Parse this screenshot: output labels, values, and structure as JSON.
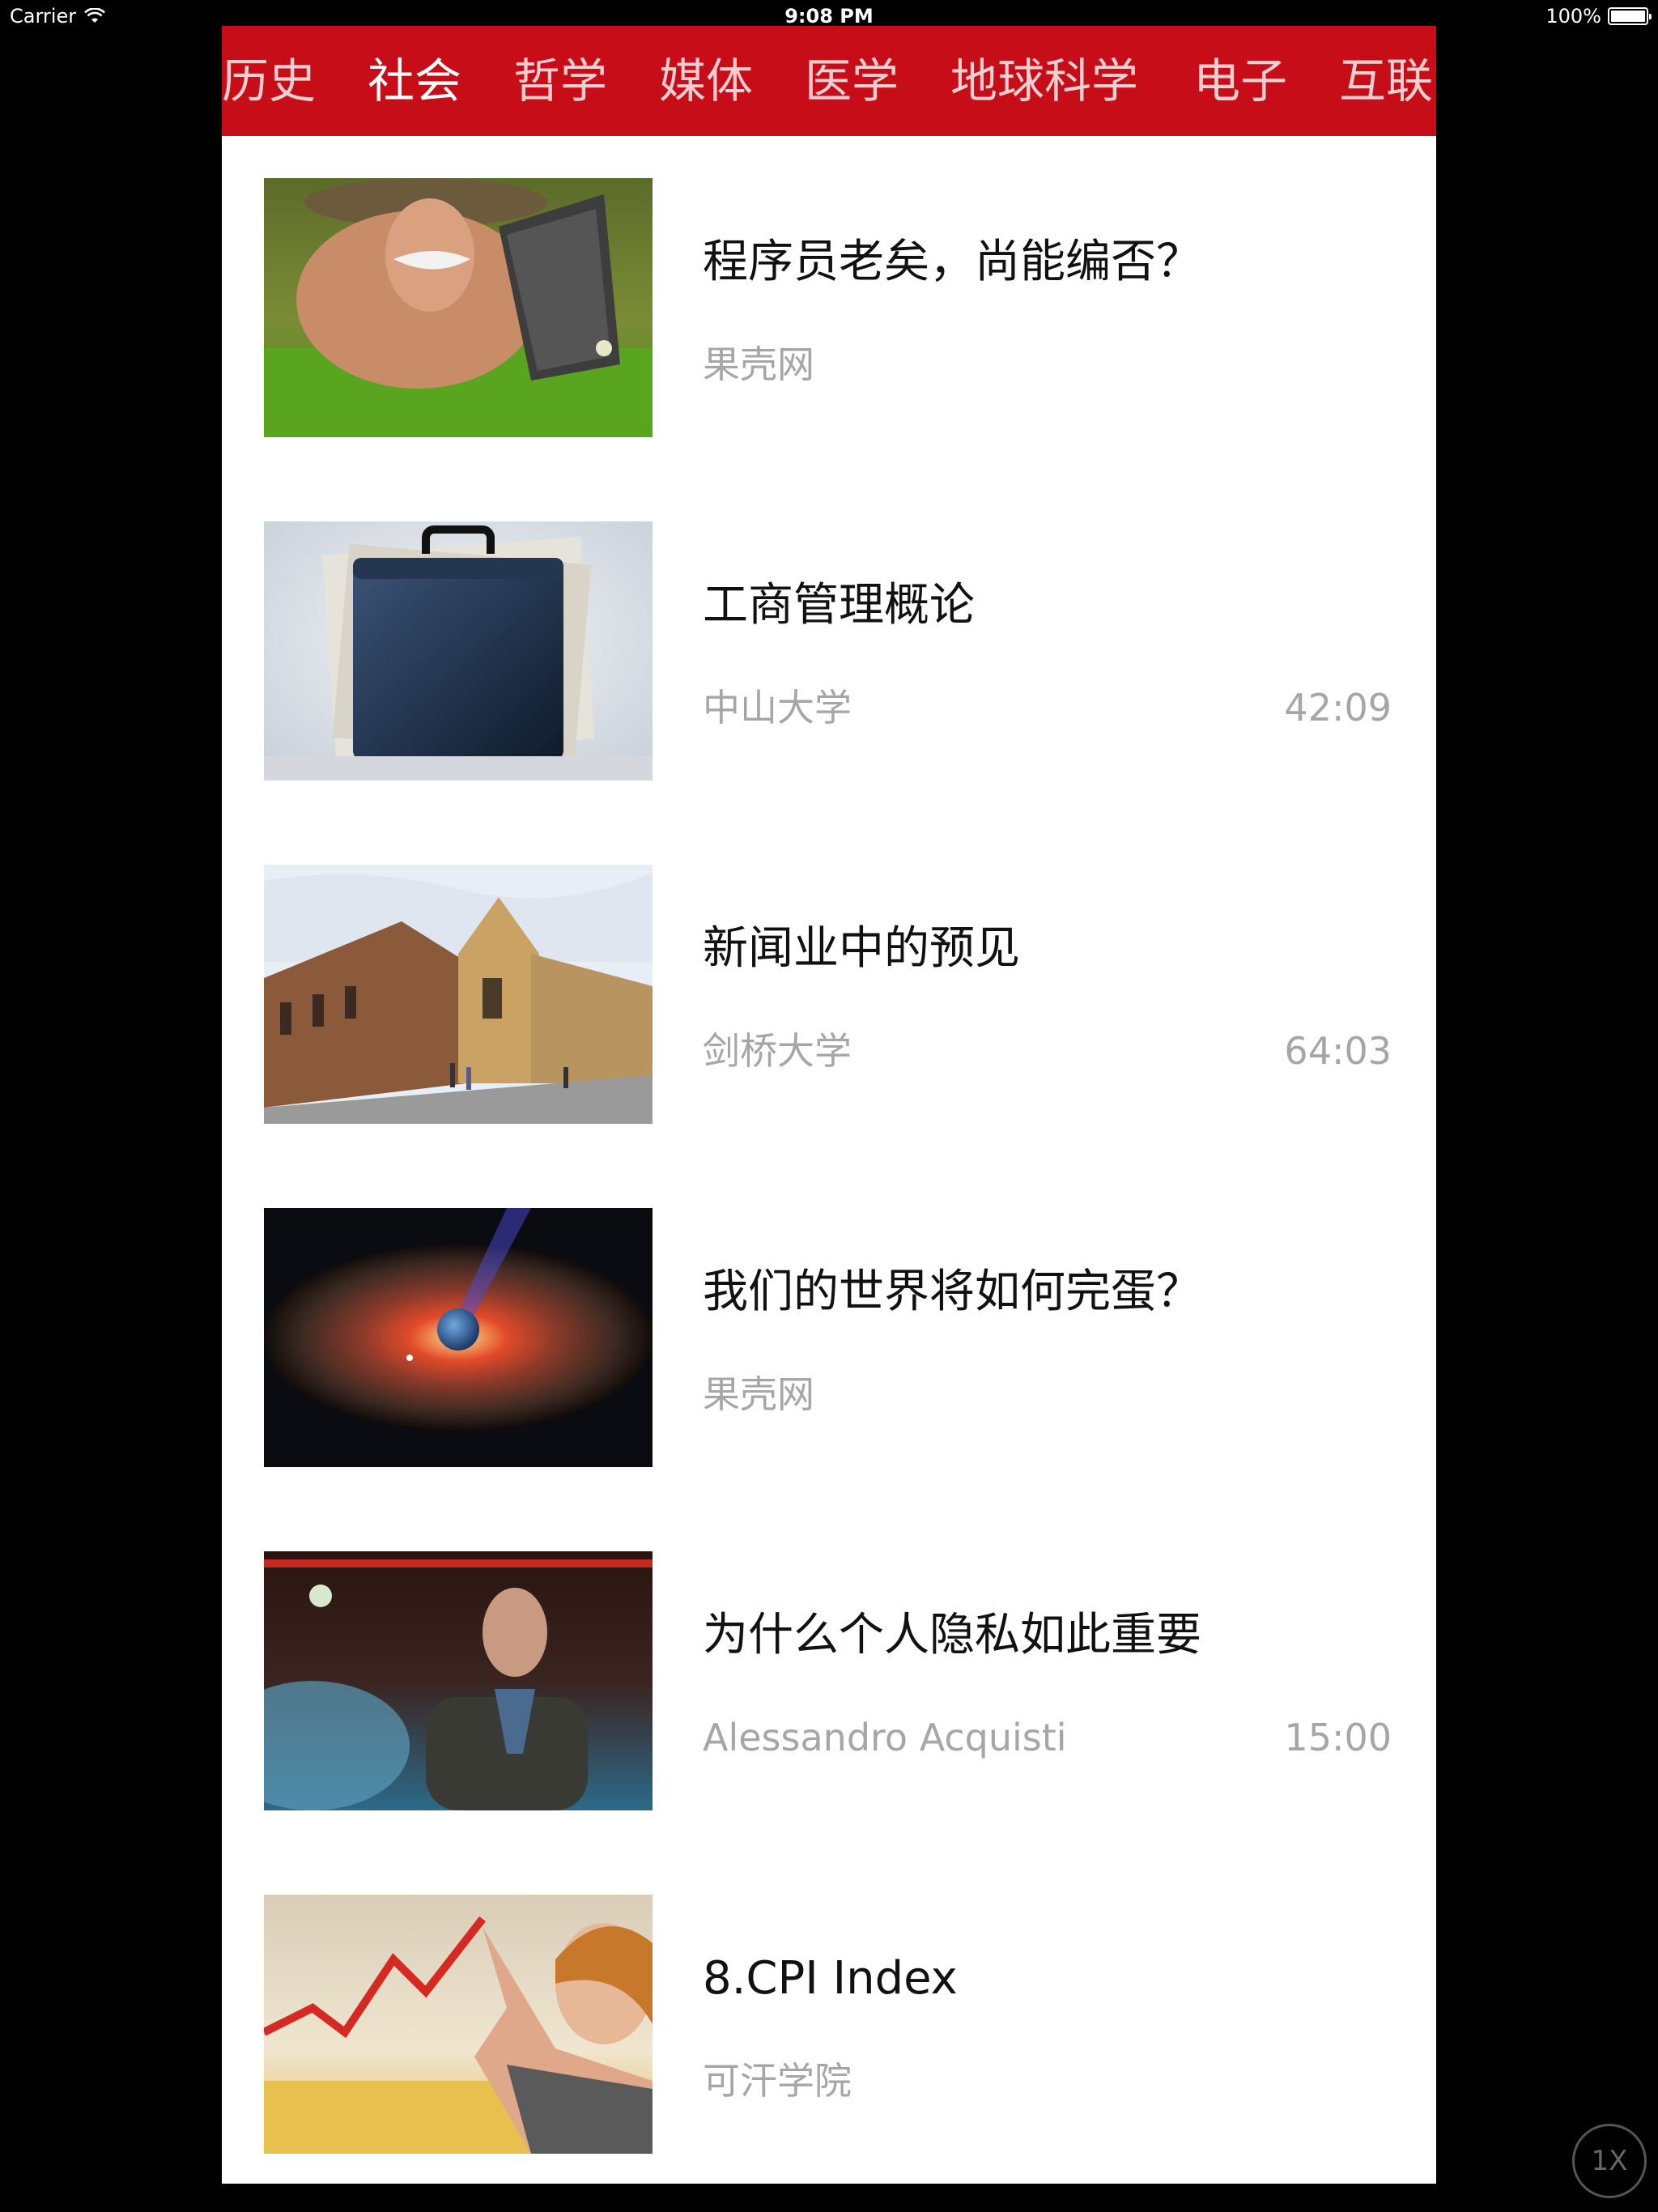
{
  "status_bar": {
    "carrier": "Carrier",
    "time": "9:08 PM",
    "battery": "100%"
  },
  "tabs": [
    {
      "label": "历史",
      "active": false
    },
    {
      "label": "社会",
      "active": true
    },
    {
      "label": "哲学",
      "active": false
    },
    {
      "label": "媒体",
      "active": false
    },
    {
      "label": "医学",
      "active": false
    },
    {
      "label": "地球科学",
      "active": false
    },
    {
      "label": "电子",
      "active": false
    },
    {
      "label": "互联",
      "active": false
    }
  ],
  "items": [
    {
      "title": "程序员老矣，尚能编否？",
      "source": "果壳网",
      "duration": "",
      "image": "old-man-with-laptop-on-grass"
    },
    {
      "title": "工商管理概论",
      "source": "中山大学",
      "duration": "42:09",
      "image": "briefcase-with-papers"
    },
    {
      "title": "新闻业中的预见",
      "source": "剑桥大学",
      "duration": "64:03",
      "image": "college-building-street"
    },
    {
      "title": "我们的世界将如何完蛋？",
      "source": "果壳网",
      "duration": "",
      "image": "earth-black-hole-space"
    },
    {
      "title": "为什么个人隐私如此重要",
      "source": "Alessandro Acquisti",
      "duration": "15:00",
      "image": "speaker-on-stage"
    },
    {
      "title": "8.CPI Index",
      "source": "可汗学院",
      "duration": "",
      "image": "woman-pointing-at-chart"
    }
  ],
  "zoom_button": "1X",
  "colors": {
    "tab_bar": "#c70d17",
    "background": "#000000",
    "secondary_text": "#a6a6a6"
  }
}
